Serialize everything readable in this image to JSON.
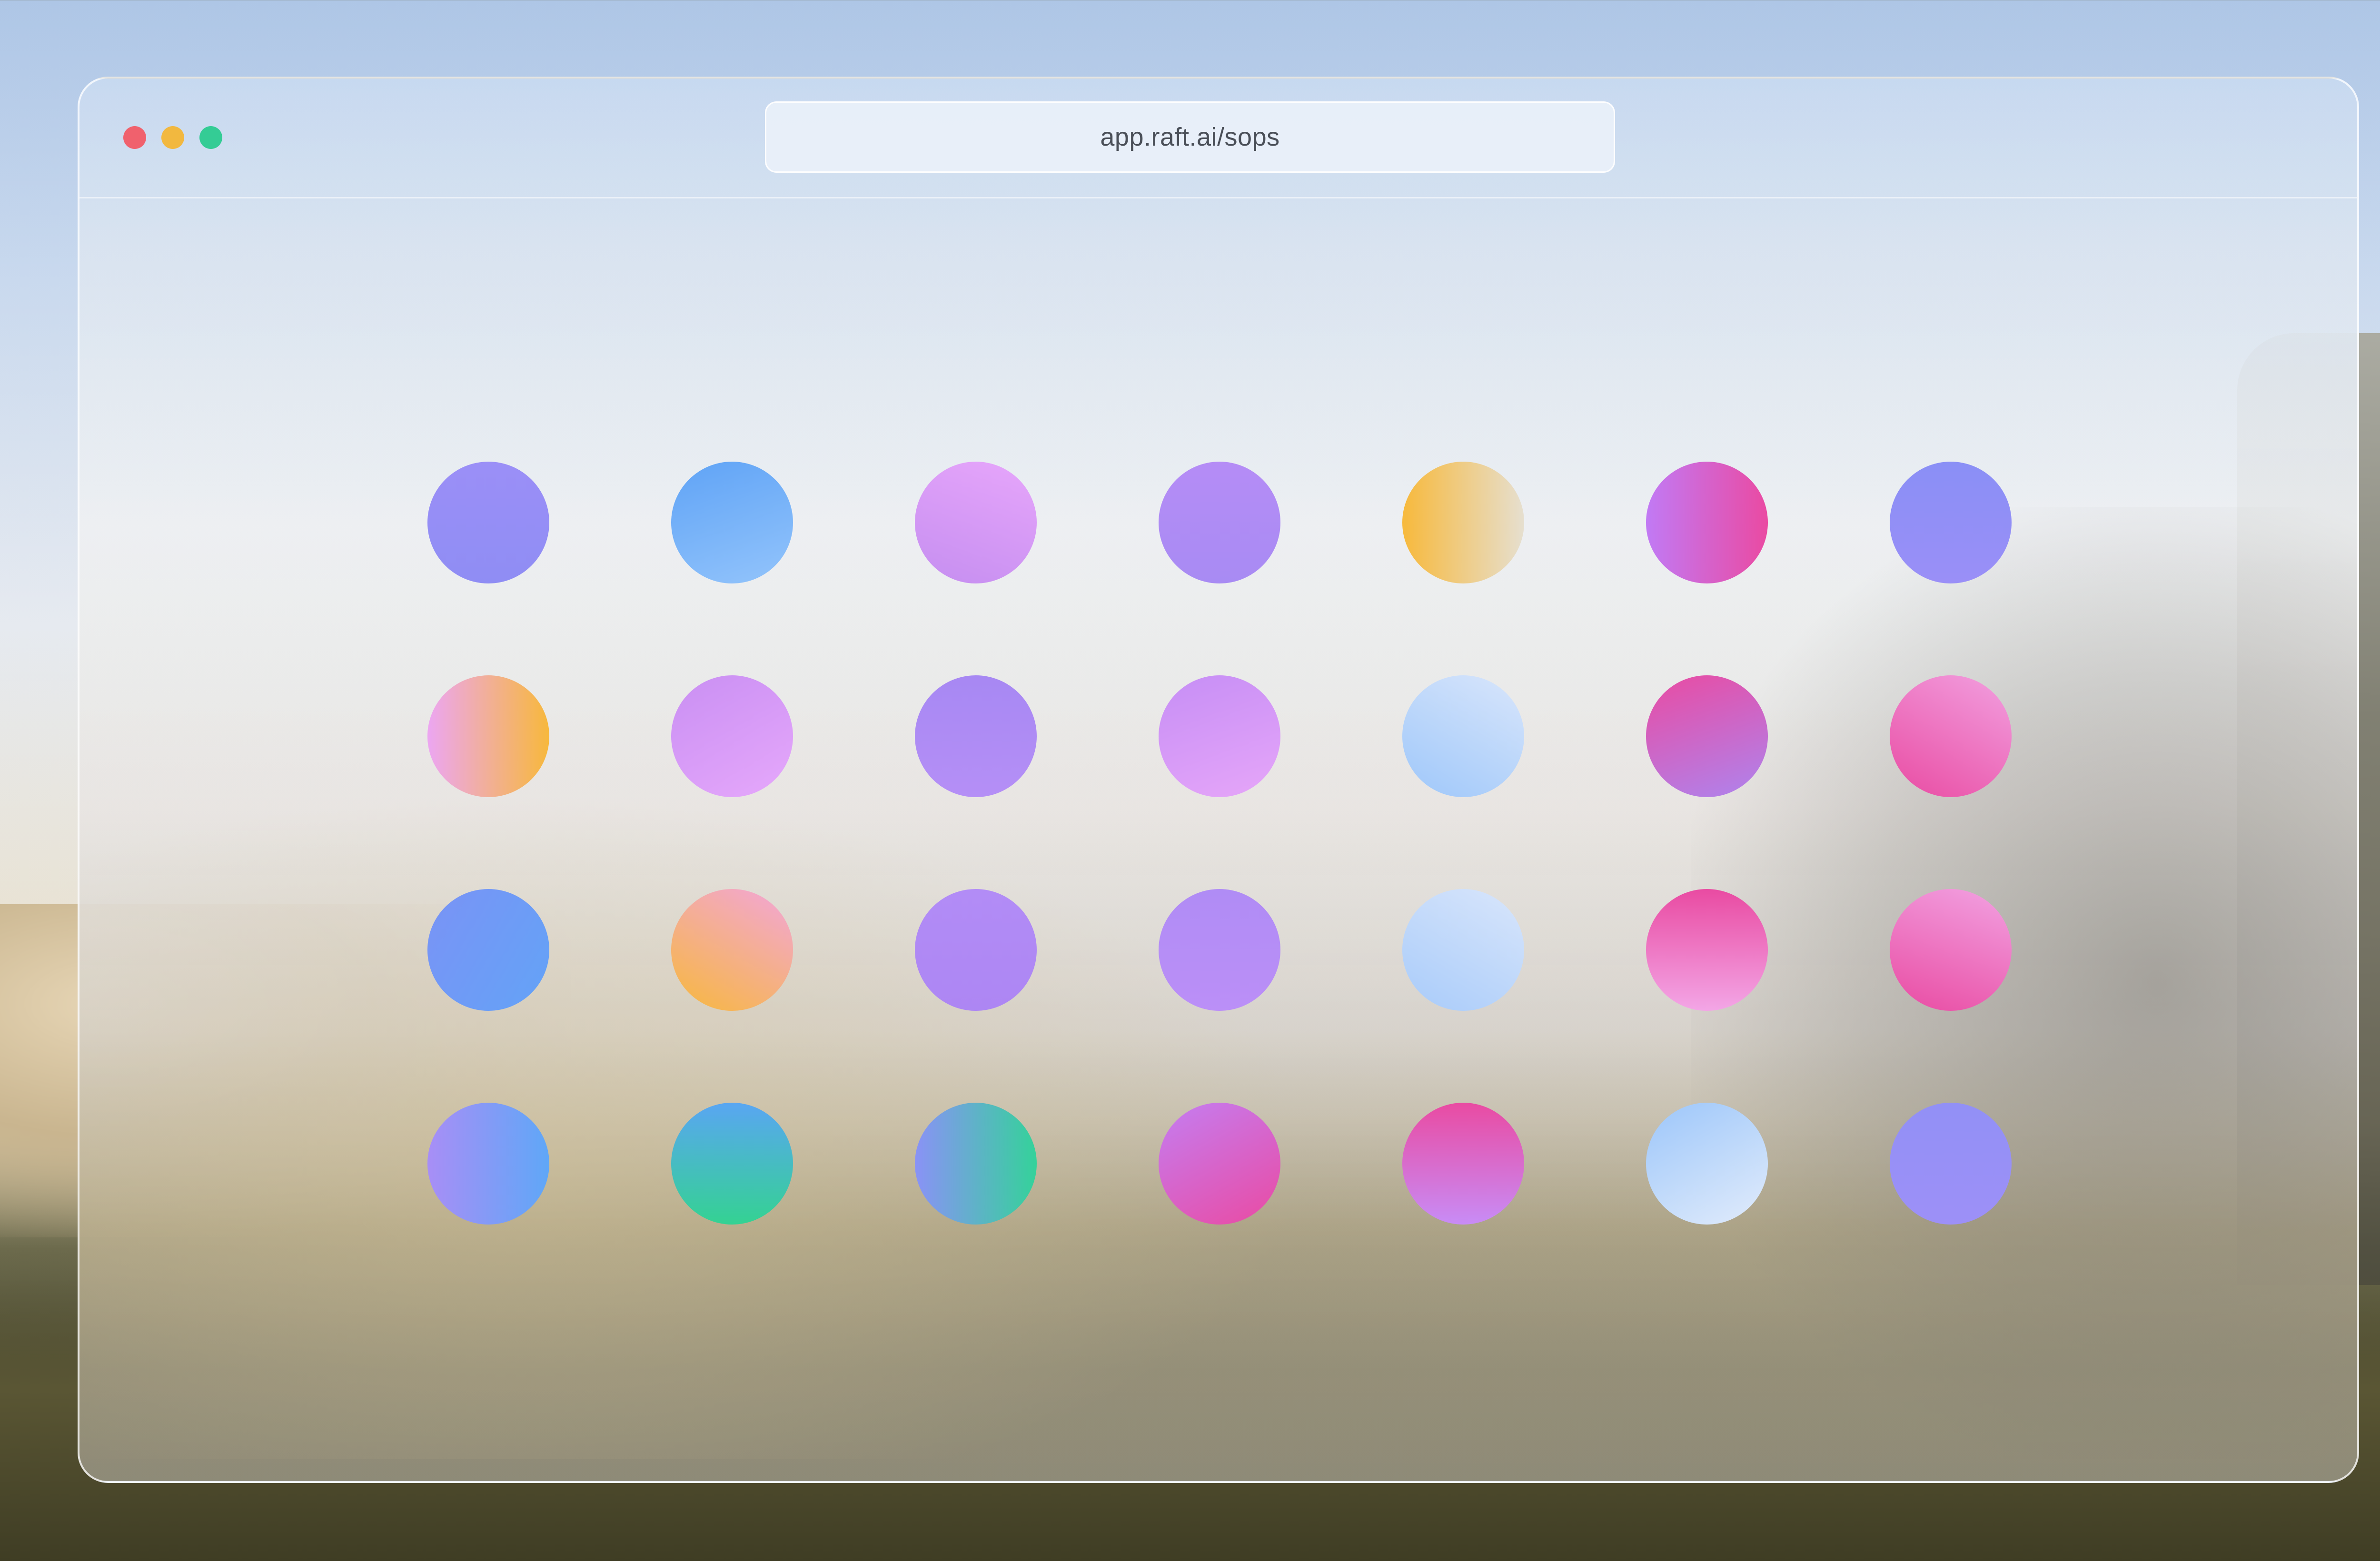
{
  "window": {
    "url": "app.raft.ai/sops",
    "controls": [
      "close",
      "minimize",
      "zoom"
    ]
  },
  "grid": {
    "rows": [
      [
        {
          "gradient": [
            "#9b8ff7",
            "#8f8df4"
          ],
          "angle": 180
        },
        {
          "gradient": [
            "#5fa3f6",
            "#93c4fb"
          ],
          "angle": 160
        },
        {
          "gradient": [
            "#e7a6fb",
            "#c58ef0"
          ],
          "angle": 200
        },
        {
          "gradient": [
            "#b58cf6",
            "#a88bf3"
          ],
          "angle": 180
        },
        {
          "gradient": [
            "#f7b93c",
            "#e6dfcf"
          ],
          "angle": 90
        },
        {
          "gradient": [
            "#c17af5",
            "#ea4aa2"
          ],
          "angle": 90
        },
        {
          "gradient": [
            "#8a8ff6",
            "#9a8ff7"
          ],
          "angle": 180
        }
      ],
      [
        {
          "gradient": [
            "#eca6f2",
            "#f7b83c"
          ],
          "angle": 90
        },
        {
          "gradient": [
            "#c98ff3",
            "#e6a8fb"
          ],
          "angle": 150
        },
        {
          "gradient": [
            "#a788f3",
            "#b58ff6"
          ],
          "angle": 180
        },
        {
          "gradient": [
            "#c68ef5",
            "#e6a6f9"
          ],
          "angle": 160
        },
        {
          "gradient": [
            "#d9e6fb",
            "#9ec7fa"
          ],
          "angle": 210
        },
        {
          "gradient": [
            "#e94ba2",
            "#ae84ee"
          ],
          "angle": 160
        },
        {
          "gradient": [
            "#f2a0e0",
            "#e94ba2"
          ],
          "angle": 210
        }
      ],
      [
        {
          "gradient": [
            "#7a93f5",
            "#63a3f7"
          ],
          "angle": 120
        },
        {
          "gradient": [
            "#f2a6da",
            "#f7b83c"
          ],
          "angle": 210
        },
        {
          "gradient": [
            "#b28cf6",
            "#ad86f3"
          ],
          "angle": 180
        },
        {
          "gradient": [
            "#b08cf5",
            "#bb8ff7"
          ],
          "angle": 180
        },
        {
          "gradient": [
            "#d9e6fb",
            "#a8cbfa"
          ],
          "angle": 210
        },
        {
          "gradient": [
            "#e94ba2",
            "#f3a6e6"
          ],
          "angle": 180
        },
        {
          "gradient": [
            "#f2a2e2",
            "#e94ba2"
          ],
          "angle": 200
        }
      ],
      [
        {
          "gradient": [
            "#a88ef6",
            "#5fa7f7"
          ],
          "angle": 90
        },
        {
          "gradient": [
            "#59a6f2",
            "#34d292"
          ],
          "angle": 180
        },
        {
          "gradient": [
            "#8a92f6",
            "#34d29a"
          ],
          "angle": 90
        },
        {
          "gradient": [
            "#c47ef2",
            "#ea4aa2"
          ],
          "angle": 150
        },
        {
          "gradient": [
            "#e94ba2",
            "#c88cf6"
          ],
          "angle": 180
        },
        {
          "gradient": [
            "#9cc6fa",
            "#e2ecfb"
          ],
          "angle": 150
        },
        {
          "gradient": [
            "#9290f6",
            "#9d90f7"
          ],
          "angle": 180
        }
      ]
    ]
  }
}
